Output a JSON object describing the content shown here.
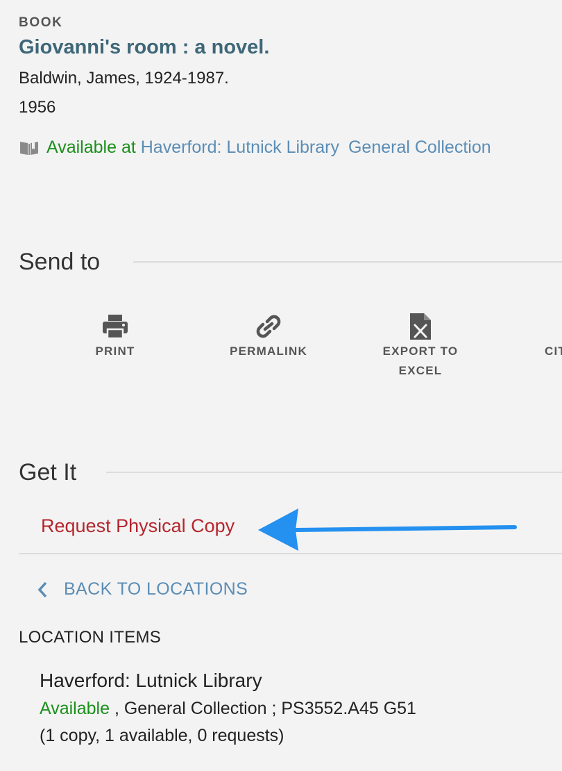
{
  "record": {
    "type": "BOOK",
    "title": "Giovanni's room : a novel.",
    "author": "Baldwin, James, 1924-1987.",
    "year": "1956",
    "availability": {
      "icon": "book-open-icon",
      "status": "Available at",
      "library": "Haverford: Lutnick Library",
      "collection": "General Collection"
    }
  },
  "send_to": {
    "heading": "Send to",
    "actions": [
      {
        "label": "PRINT",
        "icon": "printer-icon"
      },
      {
        "label": "PERMALINK",
        "icon": "link-icon"
      },
      {
        "label_line1": "EXPORT TO",
        "label_line2": "EXCEL",
        "icon": "excel-file-icon"
      },
      {
        "label": "CIT",
        "icon": "citation-icon"
      }
    ]
  },
  "get_it": {
    "heading": "Get It",
    "request_label": "Request Physical Copy",
    "back_label": "BACK TO LOCATIONS",
    "location_items_heading": "LOCATION ITEMS",
    "item": {
      "library": "Haverford: Lutnick Library",
      "status": "Available",
      "details": " , General Collection ; PS3552.A45 G51",
      "counts": "(1 copy, 1 available, 0 requests)"
    }
  },
  "colors": {
    "title": "#3e6778",
    "available": "#1c8f1c",
    "link": "#5b8db5",
    "request": "#b5262d",
    "annotation_arrow": "#2490f0"
  }
}
